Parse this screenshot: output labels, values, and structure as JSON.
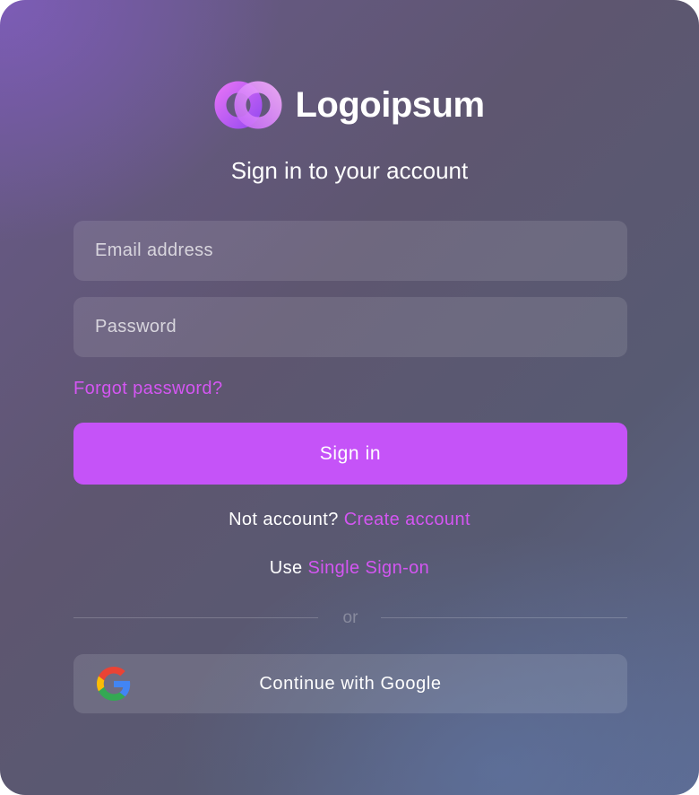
{
  "brand": {
    "name": "Logoipsum",
    "logo_icon": "logoipsum-mark-icon"
  },
  "title": "Sign in to your account",
  "form": {
    "email_placeholder": "Email address",
    "password_placeholder": "Password",
    "forgot_label": "Forgot password?",
    "submit_label": "Sign in"
  },
  "signup": {
    "prefix": "Not account?",
    "link_label": "Create account"
  },
  "sso": {
    "prefix": "Use",
    "link_label": "Single Sign-on"
  },
  "divider_label": "or",
  "google": {
    "label": "Continue with Google",
    "icon": "google-icon"
  },
  "colors": {
    "accent": "#c553f8",
    "link": "#d456f2",
    "text": "#ffffff"
  }
}
